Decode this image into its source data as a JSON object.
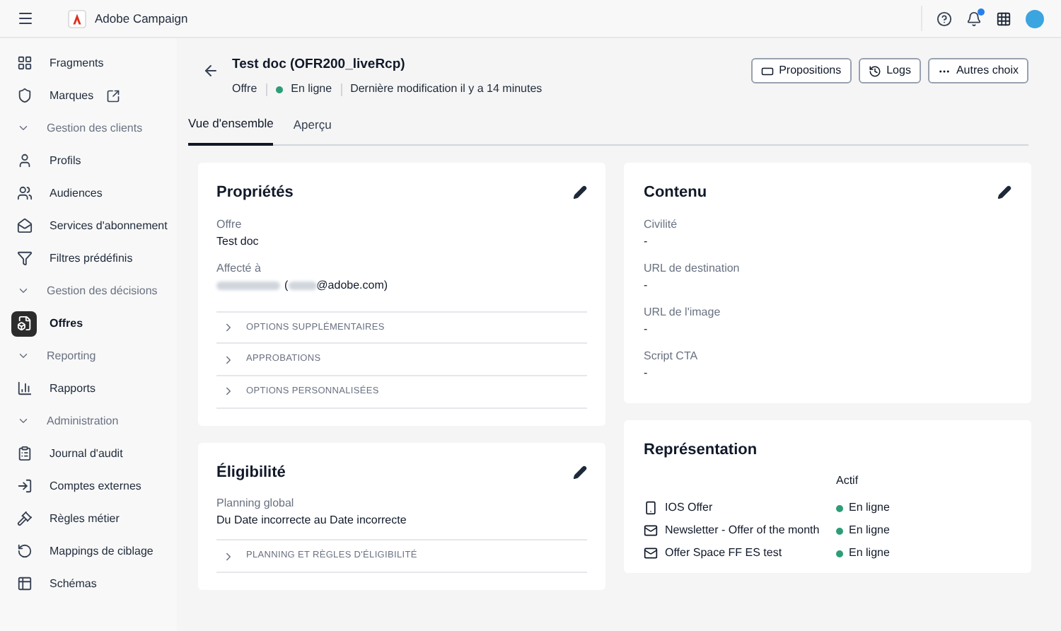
{
  "app": {
    "title": "Adobe Campaign"
  },
  "sidebar": {
    "items": [
      {
        "kind": "item",
        "label": "Fragments",
        "selected": false
      },
      {
        "kind": "item",
        "label": "Marques",
        "selected": false,
        "external": true
      },
      {
        "kind": "section",
        "label": "Gestion des clients",
        "expanded": true
      },
      {
        "kind": "item",
        "label": "Profils",
        "selected": false
      },
      {
        "kind": "item",
        "label": "Audiences",
        "selected": false
      },
      {
        "kind": "item",
        "label": "Services d'abonnement",
        "selected": false
      },
      {
        "kind": "item",
        "label": "Filtres prédéfinis",
        "selected": false
      },
      {
        "kind": "section",
        "label": "Gestion des décisions",
        "expanded": true
      },
      {
        "kind": "item",
        "label": "Offres",
        "selected": true
      },
      {
        "kind": "section",
        "label": "Reporting",
        "expanded": true
      },
      {
        "kind": "item",
        "label": "Rapports",
        "selected": false
      },
      {
        "kind": "section",
        "label": "Administration",
        "expanded": true
      },
      {
        "kind": "item",
        "label": "Journal d'audit",
        "selected": false
      },
      {
        "kind": "item",
        "label": "Comptes externes",
        "selected": false
      },
      {
        "kind": "item",
        "label": "Règles métier",
        "selected": false
      },
      {
        "kind": "item",
        "label": "Mappings de ciblage",
        "selected": false
      },
      {
        "kind": "item",
        "label": "Schémas",
        "selected": false
      }
    ]
  },
  "header": {
    "title": "Test doc (OFR200_liveRcp)",
    "type": "Offre",
    "status": {
      "label": "En ligne",
      "color": "#2d9d78"
    },
    "modified": "Dernière modification il y a 14 minutes",
    "actions": [
      "Propositions",
      "Logs",
      "Autres choix"
    ]
  },
  "tabs": [
    {
      "label": "Vue d'ensemble",
      "selected": true
    },
    {
      "label": "Aperçu",
      "selected": false
    }
  ],
  "properties": {
    "title": "Propriétés",
    "fields": [
      {
        "label": "Offre",
        "value": "Test doc"
      }
    ],
    "assigned": {
      "label": "Affecté à",
      "open": "(",
      "email_suffix": "@adobe.com)"
    },
    "sections": [
      {
        "label": "OPTIONS SUPPLÉMENTAIRES",
        "expanded": false
      },
      {
        "label": "APPROBATIONS",
        "expanded": false
      },
      {
        "label": "OPTIONS PERSONNALISÉES",
        "expanded": false
      }
    ]
  },
  "content": {
    "title": "Contenu",
    "fields": [
      {
        "label": "Civilité",
        "value": "-"
      },
      {
        "label": "URL de destination",
        "value": "-"
      },
      {
        "label": "URL de l'image",
        "value": "-"
      },
      {
        "label": "Script CTA",
        "value": "-"
      }
    ]
  },
  "eligibility": {
    "title": "Éligibilité",
    "fields": [
      {
        "label": "Planning global",
        "value": "Du Date incorrecte au Date incorrecte"
      }
    ],
    "sections": [
      {
        "label": "PLANNING ET RÈGLES D'ÉLIGIBILITÉ",
        "expanded": false
      }
    ]
  },
  "representation": {
    "title": "Représentation",
    "column": "Actif",
    "rows": [
      {
        "kind": "mobile",
        "name": "IOS Offer",
        "status": "En ligne",
        "color": "#2d9d78"
      },
      {
        "kind": "email",
        "name": "Newsletter - Offer of the month",
        "status": "En ligne",
        "color": "#2d9d78"
      },
      {
        "kind": "email",
        "name": "Offer Space FF ES test",
        "status": "En ligne",
        "color": "#2d9d78"
      }
    ]
  }
}
